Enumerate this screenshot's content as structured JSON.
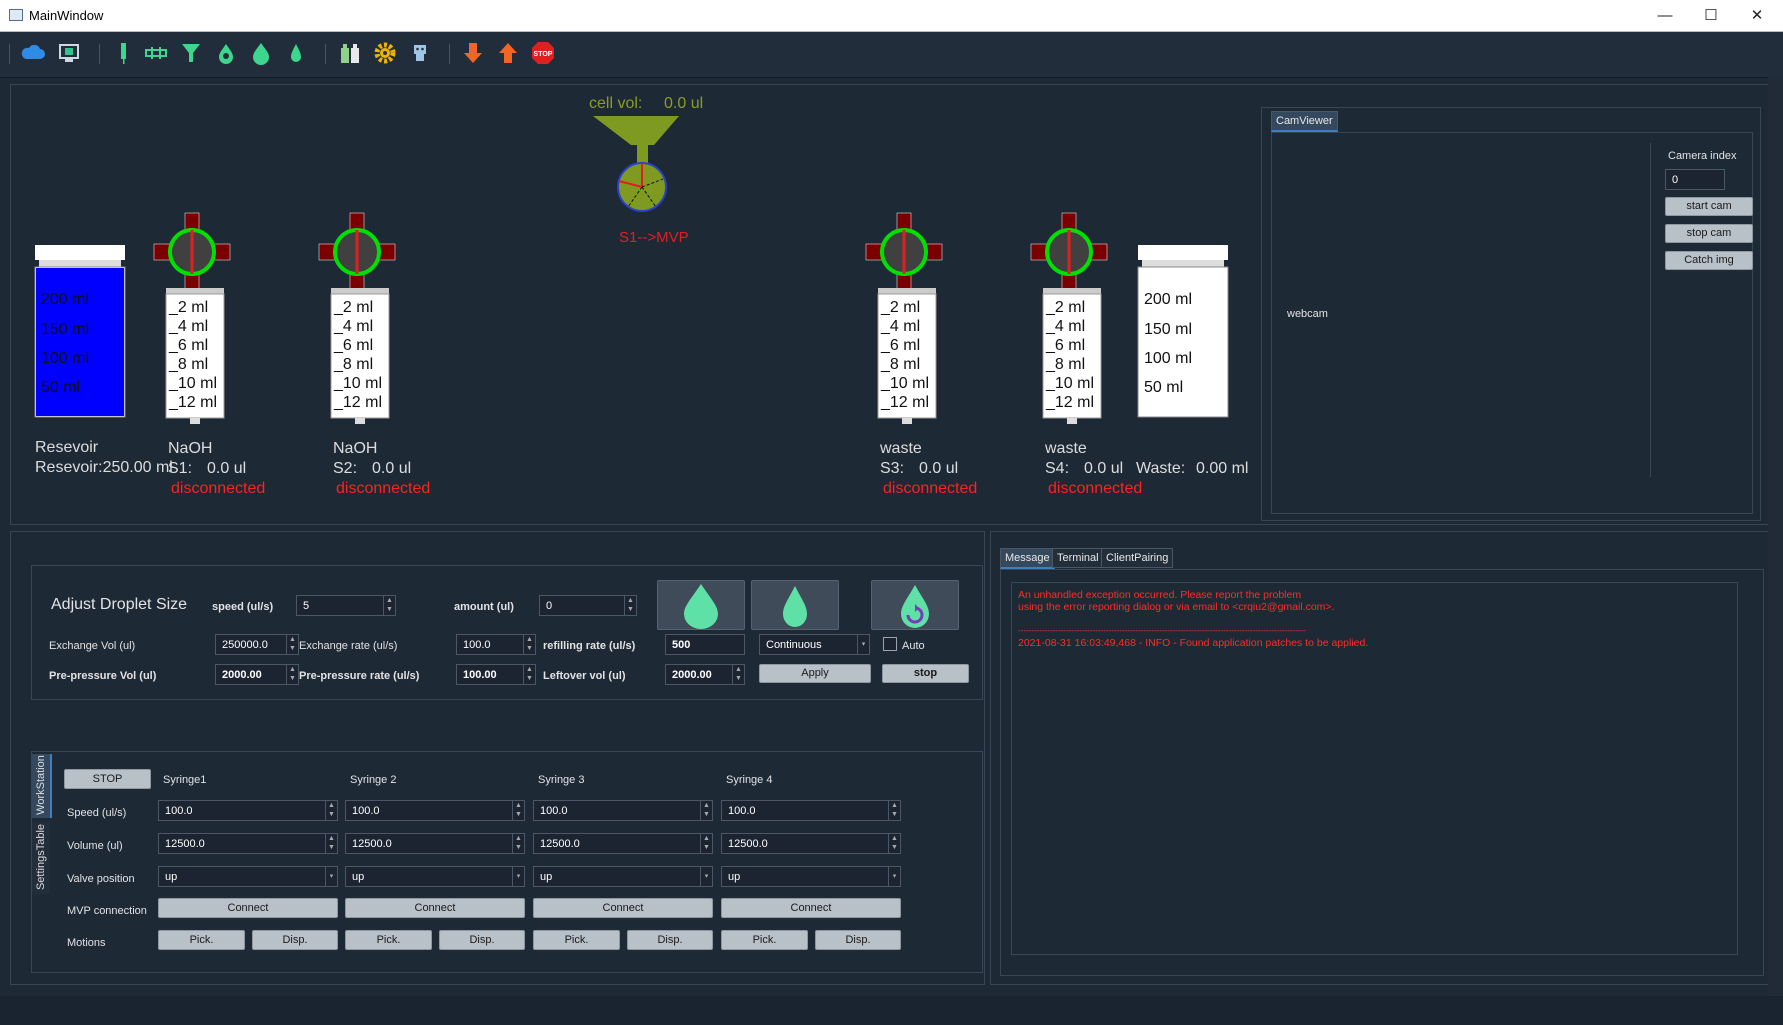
{
  "window": {
    "title": "MainWindow",
    "min": "—",
    "max": "☐",
    "close": "✕"
  },
  "toolbar": {
    "icons": [
      "cloud-icon",
      "monitor-icon",
      "syringe-icon",
      "pump-icon",
      "funnel-icon",
      "drop-small-icon",
      "drop-large-icon",
      "drop-thin-icon",
      "bottles-icon",
      "gear-icon",
      "robot-icon",
      "arrow-down-icon",
      "arrow-up-icon",
      "stop-icon"
    ]
  },
  "stage": {
    "cell_vol_label": "cell vol:",
    "cell_vol_value": "0.0 ul",
    "route": "S1-->MVP",
    "reservoir": {
      "ticks": [
        "200 ml",
        "150 ml",
        "100 ml",
        "50 ml"
      ],
      "name": "Resevoir",
      "value": "Resevoir:250.00 ml",
      "fill": 1.0
    },
    "syringe_ticks": [
      "2 ml",
      "4 ml",
      "6 ml",
      "8 ml",
      "10 ml",
      "12 ml"
    ],
    "syringes": [
      {
        "name": "NaOH",
        "id": "S1:",
        "vol": "0.0 ul",
        "status": "disconnected"
      },
      {
        "name": "NaOH",
        "id": "S2:",
        "vol": "0.0 ul",
        "status": "disconnected"
      },
      {
        "name": "waste",
        "id": "S3:",
        "vol": "0.0 ul",
        "status": "disconnected"
      },
      {
        "name": "waste",
        "id": "S4:",
        "vol": "0.0 ul",
        "status": "disconnected"
      }
    ],
    "waste": {
      "ticks": [
        "200 ml",
        "150 ml",
        "100 ml",
        "50 ml"
      ],
      "label": "Waste:",
      "value": "0.00 ml"
    }
  },
  "cam": {
    "tab": "CamViewer",
    "view_label": "webcam",
    "index_label": "Camera index",
    "index_value": "0",
    "start": "start cam",
    "stop": "stop cam",
    "catch": "Catch img"
  },
  "droplet": {
    "title": "Adjust Droplet Size",
    "speed_label": "speed (ul/s)",
    "speed_value": "5",
    "amount_label": "amount (ul)",
    "amount_value": "0",
    "exch_vol_label": "Exchange Vol (ul)",
    "exch_vol_value": "250000.0",
    "exch_rate_label": "Exchange rate (ul/s)",
    "exch_rate_value": "100.0",
    "refill_label": "refilling rate (ul/s)",
    "refill_value": "500",
    "mode_value": "Continuous",
    "auto_label": "Auto",
    "pre_vol_label": "Pre-pressure Vol (ul)",
    "pre_vol_value": "2000.00",
    "pre_rate_label": "Pre-pressure rate (ul/s)",
    "pre_rate_value": "100.00",
    "leftover_label": "Leftover vol (ul)",
    "leftover_value": "2000.00",
    "apply": "Apply",
    "stop": "stop"
  },
  "workstation": {
    "vtabs": [
      "WorkStation",
      "SettingsTable"
    ],
    "stop": "STOP",
    "columns": [
      "Syringe1",
      "Syringe 2",
      "Syringe 3",
      "Syringe 4"
    ],
    "row_labels": {
      "speed": "Speed (ul/s)",
      "volume": "Volume (ul)",
      "valve": "Valve position",
      "mvp": "MVP connection",
      "motions": "Motions"
    },
    "speed": [
      "100.0",
      "100.0",
      "100.0",
      "100.0"
    ],
    "volume": [
      "12500.0",
      "12500.0",
      "12500.0",
      "12500.0"
    ],
    "valve": [
      "up",
      "up",
      "up",
      "up"
    ],
    "connect": "Connect",
    "pick": "Pick.",
    "disp": "Disp."
  },
  "messages": {
    "tabs": [
      "Message",
      "Terminal",
      "ClientPairing"
    ],
    "lines": [
      "An unhandled exception occurred. Please report the problem",
      "using the error reporting dialog or via email to <crqiu2@gmail.com>.",
      "",
      "------------------------------------------------------------------------------------------------------------",
      "2021-08-31 16:03:49,468 - INFO - Found application patches to be applied."
    ]
  },
  "colors": {
    "bg": "#1e2936",
    "alert": "#ff2020",
    "drop": "#5fe0a6",
    "reservoir": "#0000ff",
    "funnel": "#7f9a20"
  }
}
